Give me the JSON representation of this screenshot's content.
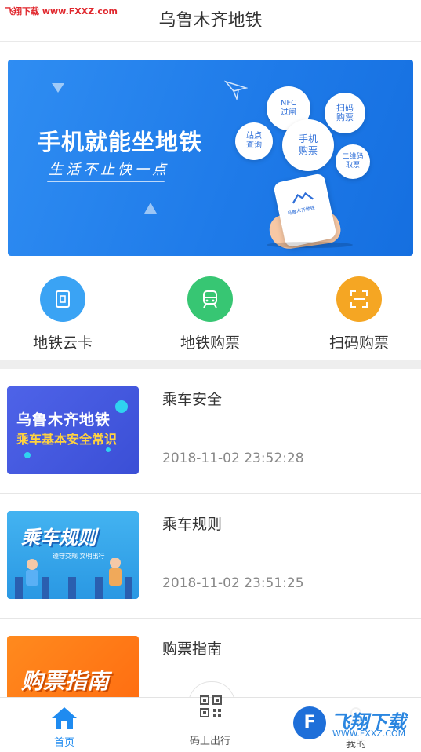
{
  "watermark": {
    "top_text": "飞翔下载 www.FXXZ.com",
    "badge_big": "飞翔下载",
    "badge_small": "WWW.FXXZ.COM",
    "badge_letter": "F"
  },
  "header": {
    "title": "乌鲁木齐地铁"
  },
  "banner": {
    "headline": "手机就能坐地铁",
    "slogan": "生活不止快一点",
    "bubbles": {
      "nfc": "NFC\n过闸",
      "scan": "扫码\n购票",
      "station": "站点\n查询",
      "phone": "手机\n购票",
      "qr": "二维码\n取票"
    },
    "phone_logo_text": "乌鲁木齐地铁"
  },
  "quick_actions": [
    {
      "label": "地铁云卡",
      "icon": "metro-card-icon",
      "color": "#3aa3f4"
    },
    {
      "label": "地铁购票",
      "icon": "train-icon",
      "color": "#37c673"
    },
    {
      "label": "扫码购票",
      "icon": "scan-icon",
      "color": "#f5a623"
    }
  ],
  "news": [
    {
      "title": "乘车安全",
      "time": "2018-11-02 23:52:28",
      "thumb_line1": "乌鲁木齐地铁",
      "thumb_line2": "乘车基本安全常识"
    },
    {
      "title": "乘车规则",
      "time": "2018-11-02 23:51:25",
      "thumb_line1": "乘车规则",
      "thumb_line2": "遵守交规 文明出行"
    },
    {
      "title": "购票指南",
      "time": "",
      "thumb_line1": "购票指南"
    }
  ],
  "tabbar": {
    "home": {
      "label": "首页",
      "icon": "home-icon"
    },
    "code": {
      "label": "码上出行",
      "icon": "qr-code-icon"
    },
    "me": {
      "label": "我的",
      "icon": "user-icon"
    }
  },
  "colors": {
    "primary": "#1f8bf0",
    "banner": "#2f8df2",
    "green": "#37c673",
    "orange": "#f5a623"
  }
}
